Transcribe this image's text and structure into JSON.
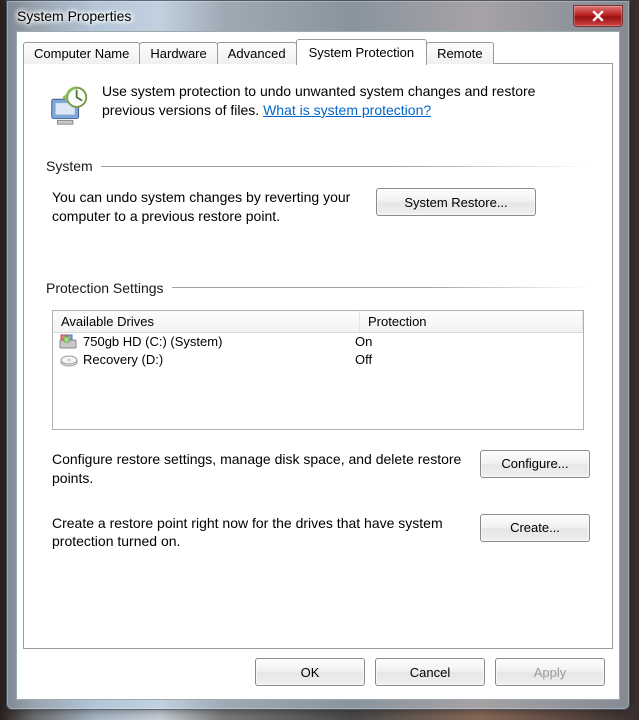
{
  "window": {
    "title": "System Properties"
  },
  "tabs": {
    "computer_name": "Computer Name",
    "hardware": "Hardware",
    "advanced": "Advanced",
    "system_protection": "System Protection",
    "remote": "Remote"
  },
  "intro": {
    "text": "Use system protection to undo unwanted system changes and restore previous versions of files. ",
    "link": "What is system protection?"
  },
  "system_group": {
    "label": "System",
    "restore_desc": "You can undo system changes by reverting your computer to a previous restore point.",
    "restore_button": "System Restore..."
  },
  "protection_group": {
    "label": "Protection Settings",
    "columns": {
      "drives": "Available Drives",
      "protection": "Protection"
    },
    "drives": [
      {
        "name": "750gb HD (C:) (System)",
        "protection": "On"
      },
      {
        "name": "Recovery (D:)",
        "protection": "Off"
      }
    ],
    "configure_desc": "Configure restore settings, manage disk space, and delete restore points.",
    "configure_button": "Configure...",
    "create_desc": "Create a restore point right now for the drives that have system protection turned on.",
    "create_button": "Create..."
  },
  "dialog_buttons": {
    "ok": "OK",
    "cancel": "Cancel",
    "apply": "Apply"
  }
}
